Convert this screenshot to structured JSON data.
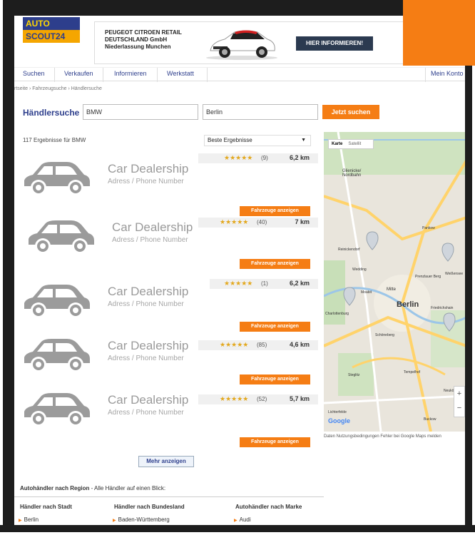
{
  "header": {
    "logo_line1": "AUTO",
    "logo_line2": "SCOUT24",
    "ad": {
      "line1": "PEUGEOT CITROEN RETAIL",
      "line2": "DEUTSCHLAND GmbH",
      "line3": "Niederlassung Munchen",
      "cta": "HIER INFORMIEREN!"
    }
  },
  "nav": {
    "items": [
      "Suchen",
      "Verkaufen",
      "Informieren",
      "Werkstatt"
    ],
    "account": "Mein Konto"
  },
  "breadcrumb": "rtseite › Fahrzeugsuche › Händlersuche",
  "search": {
    "title": "Händlersuche",
    "brand_value": "BMW",
    "city_value": "Berlin",
    "button": "Jetzt suchen"
  },
  "results": {
    "count_text": "117 Ergebnisse für BMW",
    "sort_value": "Beste Ergebnisse",
    "more_button": "Mehr anzeigen",
    "dealers": [
      {
        "name": "Car Dealership",
        "address": "Adress / Phone Number",
        "stars": "★★★★★",
        "reviews": "(9)",
        "distance": "6,2 km",
        "button": "Fahrzeuge anzeigen",
        "rating": 5
      },
      {
        "name": "Car Dealership",
        "address": "Adress / Phone Number",
        "stars": "★★★★★",
        "reviews": "(40)",
        "distance": "7 km",
        "button": "Fahrzeuge anzeigen",
        "rating": 5
      },
      {
        "name": "Car Dealership",
        "address": "Adress / Phone Number",
        "stars": "★★★★★",
        "reviews": "(1)",
        "distance": "6,2 km",
        "button": "Fahrzeuge anzeigen",
        "rating": 5
      },
      {
        "name": "Car Dealership",
        "address": "Adress / Phone Number",
        "stars": "★★★★★",
        "reviews": "(85)",
        "distance": "4,6 km",
        "button": "Fahrzeuge anzeigen",
        "rating": 5
      },
      {
        "name": "Car Dealership",
        "address": "Adress / Phone Number",
        "stars": "★★★★★",
        "reviews": "(52)",
        "distance": "5,7 km",
        "button": "Fahrzeuge anzeigen",
        "rating": 5
      }
    ]
  },
  "map": {
    "toggle_map": "Karte",
    "toggle_satellite": "Satellit",
    "city_label": "Berlin",
    "labels": [
      "Glienicke/ Nordbahn",
      "Mitte",
      "Friedrichshain",
      "Schöneberg",
      "Tempelhof",
      "Steglitz",
      "Neukölln",
      "Pankow",
      "Weißensee",
      "Wedding",
      "Reinickendorf",
      "Lichterfelde",
      "Buckow",
      "Charlottenburg",
      "Moabit",
      "Prenzlauer Berg"
    ],
    "google": "Google",
    "footer": "Daten   Nutzungsbedingungen   Fehler bei Google Maps melden",
    "zoom_in": "+",
    "zoom_out": "−"
  },
  "region": {
    "title_bold": "Autohändler nach Region",
    "title_rest": " - Alle Händler auf einen Blick:",
    "col1_head": "Händler nach Stadt",
    "col2_head": "Händler nach Bundesland",
    "col3_head": "Autohändler nach Marke",
    "col1_item": "Berlin",
    "col2_item": "Baden-Württemberg",
    "col3_item": "Audi"
  },
  "colors": {
    "brand_blue": "#2d3e8c",
    "accent_orange": "#f57d14",
    "star_gold": "#e3a81d"
  }
}
